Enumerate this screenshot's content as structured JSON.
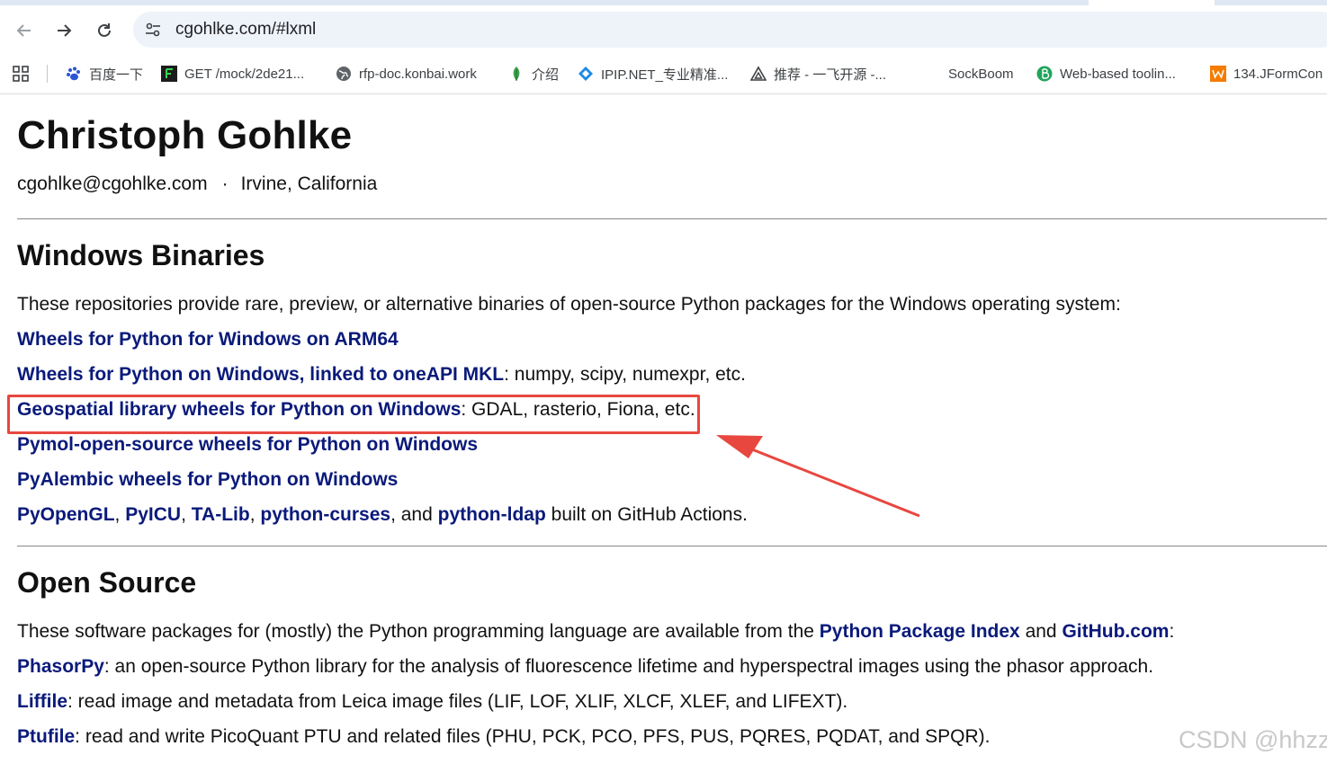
{
  "browser": {
    "url": "cgohlke.com/#lxml",
    "bookmarks": [
      {
        "label": "百度一下"
      },
      {
        "label": "GET /mock/2de21..."
      },
      {
        "label": "rfp-doc.konbai.work"
      },
      {
        "label": "介绍"
      },
      {
        "label": "IPIP.NET_专业精准..."
      },
      {
        "label": "推荐 - 一飞开源 -..."
      },
      {
        "label": "SockBoom"
      },
      {
        "label": "Web-based toolin..."
      },
      {
        "label": "134.JFormCon"
      }
    ]
  },
  "header": {
    "name": "Christoph Gohlke",
    "email": "cgohlke@cgohlke.com",
    "dot": "·",
    "location": "Irvine, California"
  },
  "windows": {
    "title": "Windows Binaries",
    "intro": "These repositories provide rare, preview, or alternative binaries of open-source Python packages for the Windows operating system:",
    "arm64": "Wheels for Python for Windows on ARM64",
    "mkl_link": "Wheels for Python on Windows, linked to oneAPI MKL",
    "mkl_rest": ": numpy, scipy, numexpr, etc.",
    "geo_link": "Geospatial library wheels for Python on Windows",
    "geo_rest": ": GDAL, rasterio, Fiona, etc.",
    "pymol": "Pymol-open-source wheels for Python on Windows",
    "pyalembic": "PyAlembic wheels for Python on Windows",
    "pyopengl": "PyOpenGL",
    "pyicu": "PyICU",
    "talib": "TA-Lib",
    "pycurses": "python-curses",
    "pyldap": "python-ldap",
    "comma": ",",
    "and": ", and",
    "built": "built on GitHub Actions."
  },
  "open_source": {
    "title": "Open Source",
    "intro_pre": "These software packages for (mostly) the Python programming language are available from the",
    "ppi": "Python Package Index",
    "and": "and",
    "github": "GitHub.com",
    "colon": ":",
    "phasorpy": "PhasorPy",
    "phasorpy_desc": ": an open-source Python library for the analysis of fluorescence lifetime and hyperspectral images using the phasor approach.",
    "liffile": "Liffile",
    "liffile_desc": ": read image and metadata from Leica image files (LIF, LOF, XLIF, XLCF, XLEF, and LIFEXT).",
    "ptufile": "Ptufile",
    "ptufile_desc": ": read and write PicoQuant PTU and related files (PHU, PCK, PCO, PFS, PUS, PQRES, PQDAT, and SPQR)."
  },
  "watermark": "CSDN @hhzz",
  "colors": {
    "link": "#0a1a7a",
    "highlight": "#e8473f",
    "omnibox": "#eef2f9"
  }
}
